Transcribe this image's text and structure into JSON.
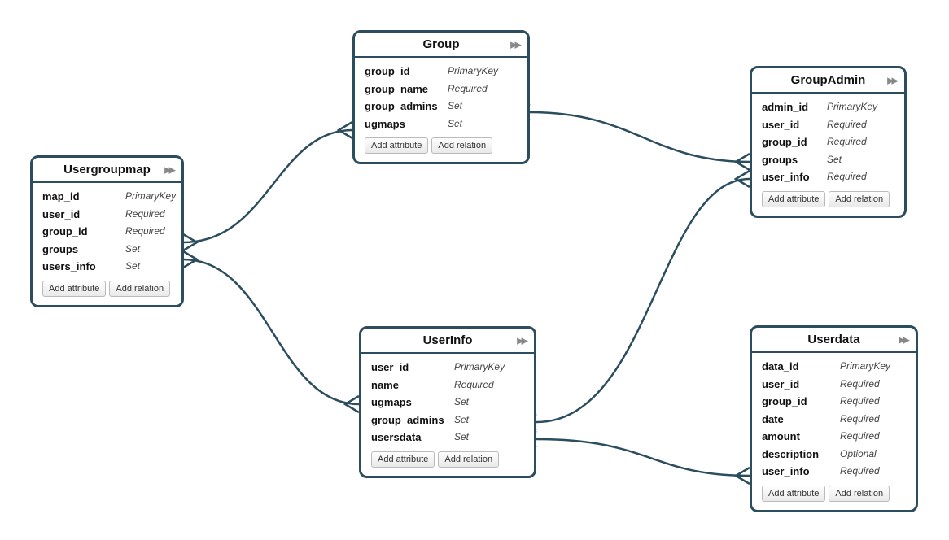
{
  "buttons": {
    "add_attribute": "Add attribute",
    "add_relation": "Add relation"
  },
  "entities": {
    "usergroupmap": {
      "title": "Usergroupmap",
      "attrs": [
        {
          "name": "map_id",
          "type": "PrimaryKey"
        },
        {
          "name": "user_id",
          "type": "Required"
        },
        {
          "name": "group_id",
          "type": "Required"
        },
        {
          "name": "groups",
          "type": "Set"
        },
        {
          "name": "users_info",
          "type": "Set"
        }
      ]
    },
    "group": {
      "title": "Group",
      "attrs": [
        {
          "name": "group_id",
          "type": "PrimaryKey"
        },
        {
          "name": "group_name",
          "type": "Required"
        },
        {
          "name": "group_admins",
          "type": "Set"
        },
        {
          "name": "ugmaps",
          "type": "Set"
        }
      ]
    },
    "groupadmin": {
      "title": "GroupAdmin",
      "attrs": [
        {
          "name": "admin_id",
          "type": "PrimaryKey"
        },
        {
          "name": "user_id",
          "type": "Required"
        },
        {
          "name": "group_id",
          "type": "Required"
        },
        {
          "name": "groups",
          "type": "Set"
        },
        {
          "name": "user_info",
          "type": "Required"
        }
      ]
    },
    "userinfo": {
      "title": "UserInfo",
      "attrs": [
        {
          "name": "user_id",
          "type": "PrimaryKey"
        },
        {
          "name": "name",
          "type": "Required"
        },
        {
          "name": "ugmaps",
          "type": "Set"
        },
        {
          "name": "group_admins",
          "type": "Set"
        },
        {
          "name": "usersdata",
          "type": "Set"
        }
      ]
    },
    "userdata": {
      "title": "Userdata",
      "attrs": [
        {
          "name": "data_id",
          "type": "PrimaryKey"
        },
        {
          "name": "user_id",
          "type": "Required"
        },
        {
          "name": "group_id",
          "type": "Required"
        },
        {
          "name": "date",
          "type": "Required"
        },
        {
          "name": "amount",
          "type": "Required"
        },
        {
          "name": "description",
          "type": "Optional"
        },
        {
          "name": "user_info",
          "type": "Required"
        }
      ]
    }
  }
}
